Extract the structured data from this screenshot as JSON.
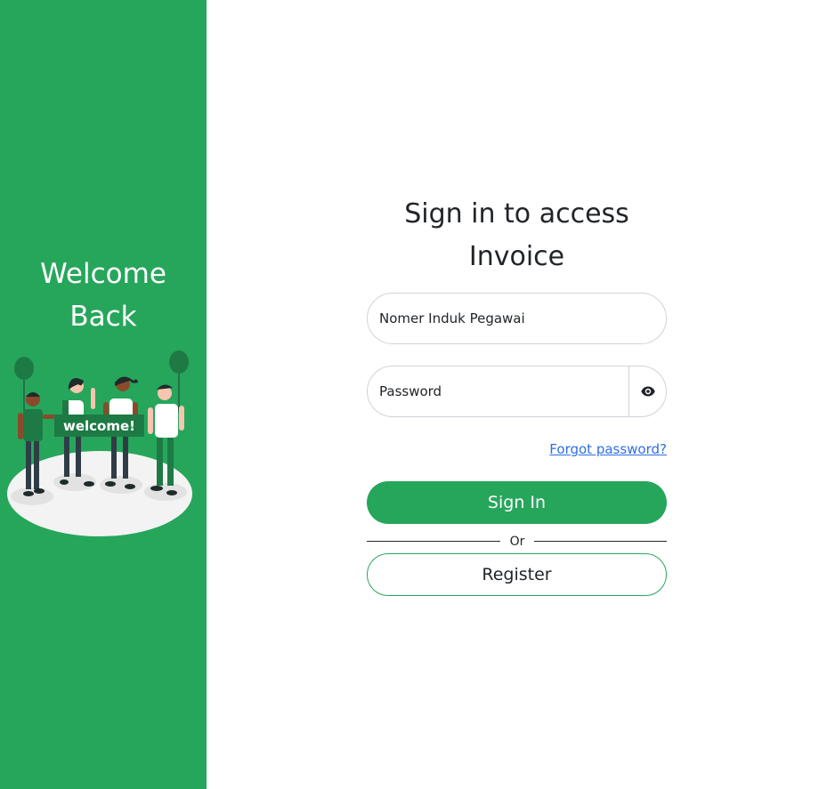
{
  "sidebar": {
    "welcome_title": "Welcome\nBack",
    "illustration": {
      "icon": "welcome-people-illustration",
      "banner_text": "welcome!"
    }
  },
  "form": {
    "title": "Sign in to access\nInvoice",
    "nip_placeholder": "Nomer Induk Pegawai",
    "password_placeholder": "Password",
    "password_toggle_icon": "eye-icon",
    "forgot_password": "Forgot password?",
    "sign_in": "Sign In",
    "or": "Or",
    "register": "Register"
  },
  "colors": {
    "brand_green": "#26a65b",
    "link_blue": "#2e6ee6",
    "text": "#212529",
    "input_border": "#ced4da"
  }
}
